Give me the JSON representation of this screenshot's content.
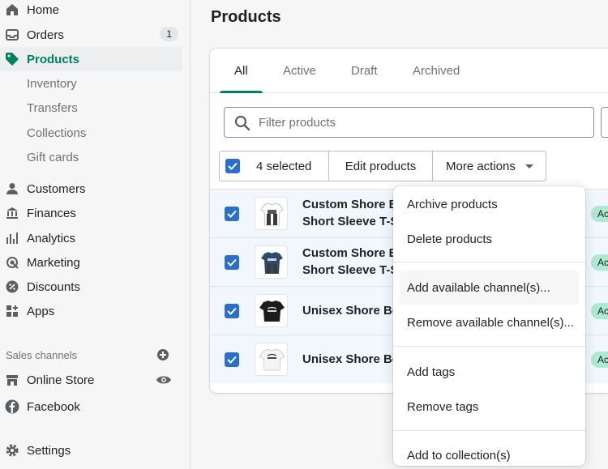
{
  "sidebar": {
    "nav": [
      {
        "label": "Home",
        "icon": "home-icon"
      },
      {
        "label": "Orders",
        "icon": "orders-icon",
        "badge": "1"
      },
      {
        "label": "Products",
        "icon": "tag-icon",
        "active": true
      },
      {
        "label": "Customers",
        "icon": "person-icon"
      },
      {
        "label": "Finances",
        "icon": "bank-icon"
      },
      {
        "label": "Analytics",
        "icon": "bar-chart-icon"
      },
      {
        "label": "Marketing",
        "icon": "target-icon"
      },
      {
        "label": "Discounts",
        "icon": "discount-icon"
      },
      {
        "label": "Apps",
        "icon": "apps-icon"
      }
    ],
    "product_sub": [
      "Inventory",
      "Transfers",
      "Collections",
      "Gift cards"
    ],
    "sales_channels_title": "Sales channels",
    "channels": [
      {
        "label": "Online Store",
        "icon": "store-icon"
      },
      {
        "label": "Facebook",
        "icon": "facebook-icon"
      }
    ],
    "settings_label": "Settings"
  },
  "page": {
    "title": "Products"
  },
  "tabs": [
    "All",
    "Active",
    "Draft",
    "Archived"
  ],
  "filter": {
    "placeholder": "Filter products",
    "value": ""
  },
  "bulk": {
    "selected_label": "4 selected",
    "edit_label": "Edit products",
    "more_label": "More actions"
  },
  "products": [
    {
      "line1": "Custom Shore B",
      "line2": "Short Sleeve T-S",
      "status": "Ac",
      "shirt": "#ffffff"
    },
    {
      "line1": "Custom Shore B",
      "line2": "Short Sleeve T-S",
      "status": "Ac",
      "shirt": "#2f4a6d"
    },
    {
      "line1": "Unisex Shore Bo",
      "line2": "",
      "status": "Ac",
      "shirt": "#1c1c1c"
    },
    {
      "line1": "Unisex Shore Bo",
      "line2": "",
      "status": "Ac",
      "shirt": "#f4f4f4"
    }
  ],
  "more_actions_menu": {
    "group1": [
      "Archive products",
      "Delete products"
    ],
    "group2": [
      "Add available channel(s)...",
      "Remove available channel(s)..."
    ],
    "group3": [
      "Add tags",
      "Remove tags"
    ],
    "group4": [
      "Add to collection(s)"
    ]
  },
  "colors": {
    "accent": "#008060",
    "checkbox": "#2c6ecb",
    "selected_row": "#f2f7fe"
  }
}
